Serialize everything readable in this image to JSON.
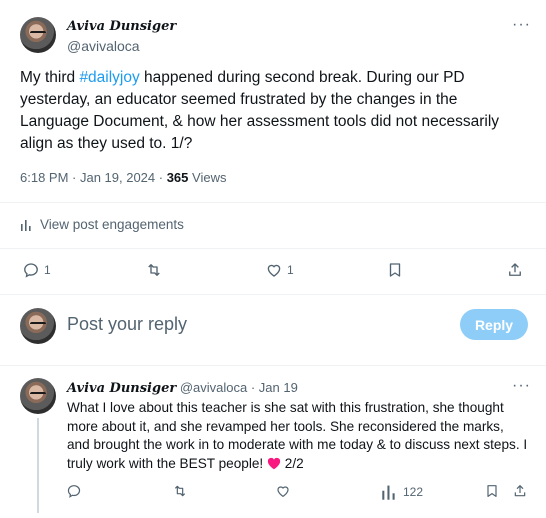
{
  "main_post": {
    "author_name": "Aviva Dunsiger",
    "handle": "@avivaloca",
    "text_before": "My third ",
    "hashtag": "#dailyjoy",
    "text_after": " happened during second break. During our PD yesterday, an educator seemed frustrated by the changes in the Language Document, & how her assessment tools did not necessarily align as they used to. 1/?",
    "timestamp": "6:18 PM · Jan 19, 2024 · ",
    "views_count": "365",
    "views_label": "Views",
    "engagements_label": "View post engagements",
    "reply_count": "1",
    "like_count": "1"
  },
  "composer": {
    "placeholder": "Post your reply",
    "reply_button": "Reply"
  },
  "reply_post": {
    "author_name": "Aviva Dunsiger",
    "handle": "@avivaloca",
    "separator": " · ",
    "date": "Jan 19",
    "text": "What I love about this teacher is she sat with this frustration, she thought more about it, and she revamped her tools. She reconsidered the marks, and brought the work in to moderate with me today & to discuss next steps. I truly work with the BEST people!",
    "suffix": "2/2",
    "views_count": "122"
  },
  "colors": {
    "accent": "#1d9bf0",
    "reply_button_bg": "#8ecdf8",
    "heart": "#f91880",
    "muted": "#536471"
  },
  "icons": [
    "more-icon",
    "analytics-icon",
    "reply-icon",
    "repost-icon",
    "like-icon",
    "bookmark-icon",
    "share-icon",
    "heart-emoji-icon"
  ]
}
